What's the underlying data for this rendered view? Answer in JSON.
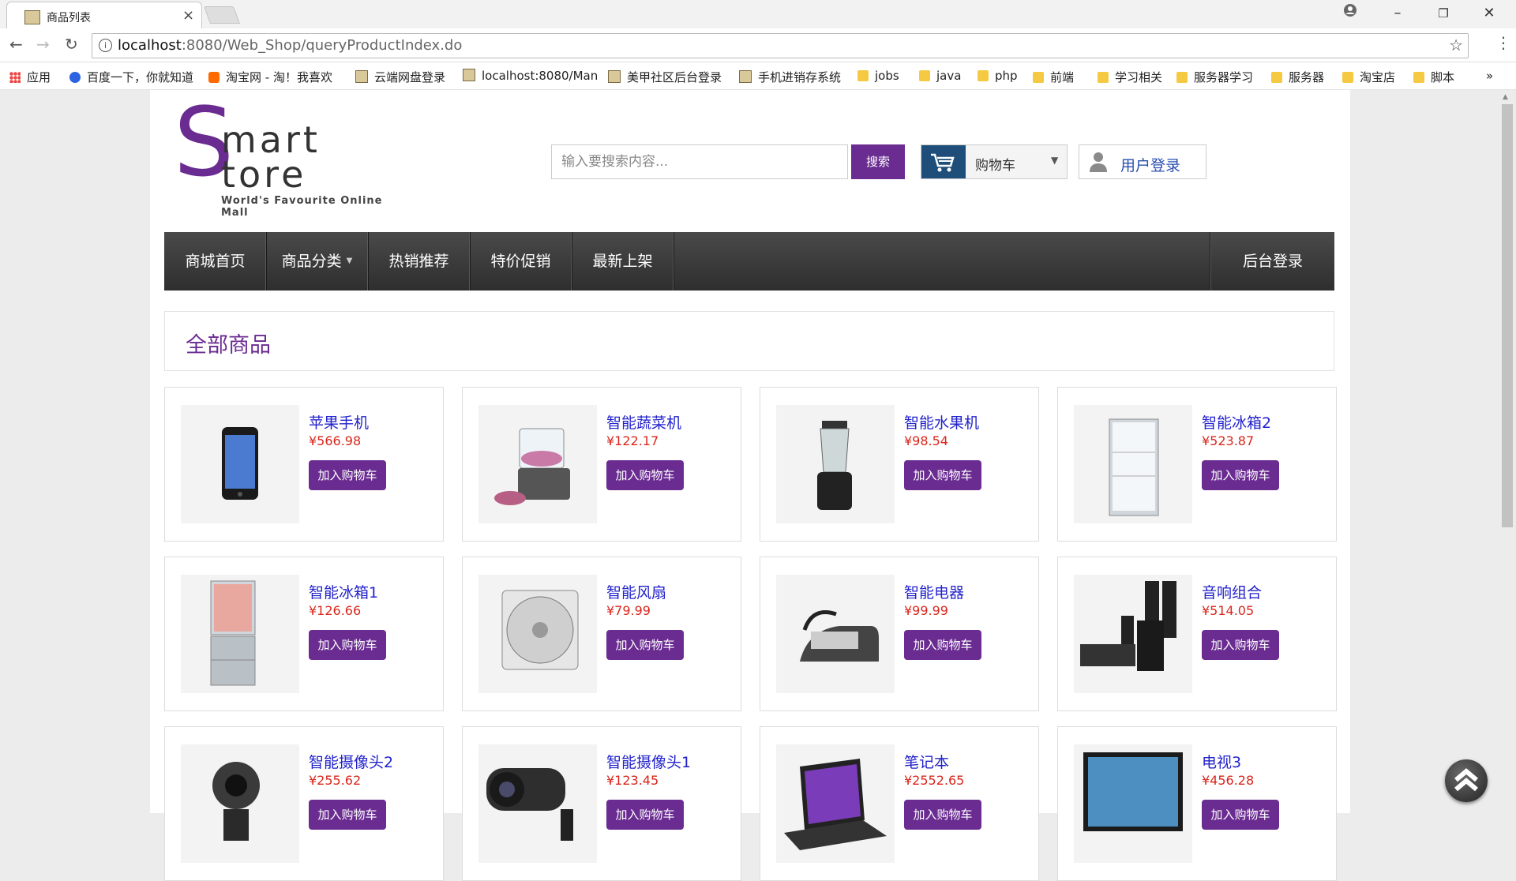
{
  "browser": {
    "tab_title": "商品列表",
    "url_host": "localhost",
    "url_path": ":8080/Web_Shop/queryProductIndex.do",
    "bookmarks": [
      {
        "label": "应用",
        "icon": "apps-grid-icon"
      },
      {
        "label": "百度一下，你就知道",
        "icon": "baidu-paw-icon"
      },
      {
        "label": "淘宝网 - 淘！我喜欢",
        "icon": "taobao-icon"
      },
      {
        "label": "云端网盘登录",
        "icon": "image-icon"
      },
      {
        "label": "localhost:8080/Man",
        "icon": "image-icon"
      },
      {
        "label": "美甲社区后台登录",
        "icon": "image-icon"
      },
      {
        "label": "手机进销存系统",
        "icon": "image-icon"
      },
      {
        "label": "jobs",
        "icon": "folder-icon"
      },
      {
        "label": "java",
        "icon": "folder-icon"
      },
      {
        "label": "php",
        "icon": "folder-icon"
      },
      {
        "label": "前端",
        "icon": "folder-icon"
      },
      {
        "label": "学习相关",
        "icon": "folder-icon"
      },
      {
        "label": "服务器学习",
        "icon": "folder-icon"
      },
      {
        "label": "服务器",
        "icon": "folder-icon"
      },
      {
        "label": "淘宝店",
        "icon": "folder-icon"
      },
      {
        "label": "脚本",
        "icon": "folder-icon"
      }
    ],
    "more_bookmarks": "»"
  },
  "header": {
    "logo_s": "S",
    "logo_mart": "mart",
    "logo_tore": "tore",
    "logo_tagline": "World's Favourite Online Mall",
    "search_placeholder": "输入要搜索内容...",
    "search_button": "搜索",
    "cart_label": "购物车",
    "login_label": "用户登录"
  },
  "nav": {
    "items": [
      "商城首页",
      "商品分类",
      "热销推荐",
      "特价促销",
      "最新上架"
    ],
    "right_item": "后台登录"
  },
  "section_title": "全部商品",
  "products": [
    {
      "name": "苹果手机",
      "price": "¥566.98",
      "button": "加入购物车"
    },
    {
      "name": "智能蔬菜机",
      "price": "¥122.17",
      "button": "加入购物车"
    },
    {
      "name": "智能水果机",
      "price": "¥98.54",
      "button": "加入购物车"
    },
    {
      "name": "智能冰箱2",
      "price": "¥523.87",
      "button": "加入购物车"
    },
    {
      "name": "智能冰箱1",
      "price": "¥126.66",
      "button": "加入购物车"
    },
    {
      "name": "智能风扇",
      "price": "¥79.99",
      "button": "加入购物车"
    },
    {
      "name": "智能电器",
      "price": "¥99.99",
      "button": "加入购物车"
    },
    {
      "name": "音响组合",
      "price": "¥514.05",
      "button": "加入购物车"
    },
    {
      "name": "智能摄像头2",
      "price": "¥255.62",
      "button": "加入购物车"
    },
    {
      "name": "智能摄像头1",
      "price": "¥123.45",
      "button": "加入购物车"
    },
    {
      "name": "笔记本",
      "price": "¥2552.65",
      "button": "加入购物车"
    },
    {
      "name": "电视3",
      "price": "¥456.28",
      "button": "加入购物车"
    }
  ],
  "colors": {
    "brand": "#6a2c91",
    "price": "#d9261c",
    "link": "#2222cc",
    "cart_icon_bg": "#1e4e79"
  }
}
